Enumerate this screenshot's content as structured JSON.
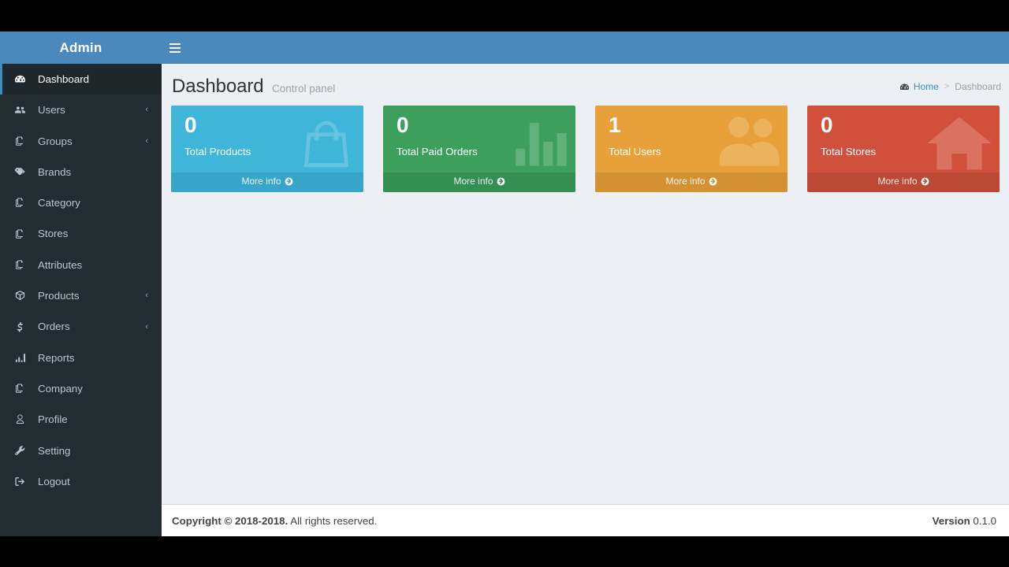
{
  "app": {
    "brand": "Admin",
    "navbar": {
      "toggle_icon": "hamburger-icon"
    },
    "colors": {
      "navbar_blue": "#4b89bc",
      "sidebar_dark": "#222d32",
      "sidebar_active": "#1e282c",
      "accent": "#3c8dbc",
      "content_bg": "#ecf0f5",
      "box_aqua": "#3fb5da",
      "box_green": "#3c9f5c",
      "box_yellow": "#e8a13a",
      "box_red": "#d1503c"
    }
  },
  "sidebar": {
    "items": [
      {
        "label": "Dashboard",
        "icon": "dashboard-icon",
        "active": true,
        "caret": false
      },
      {
        "label": "Users",
        "icon": "users-icon",
        "active": false,
        "caret": true
      },
      {
        "label": "Groups",
        "icon": "copy-icon",
        "active": false,
        "caret": true
      },
      {
        "label": "Brands",
        "icon": "tags-icon",
        "active": false,
        "caret": false
      },
      {
        "label": "Category",
        "icon": "copy-icon",
        "active": false,
        "caret": false
      },
      {
        "label": "Stores",
        "icon": "copy-icon",
        "active": false,
        "caret": false
      },
      {
        "label": "Attributes",
        "icon": "copy-icon",
        "active": false,
        "caret": false
      },
      {
        "label": "Products",
        "icon": "cube-icon",
        "active": false,
        "caret": true
      },
      {
        "label": "Orders",
        "icon": "dollar-icon",
        "active": false,
        "caret": true
      },
      {
        "label": "Reports",
        "icon": "bar-chart-icon",
        "active": false,
        "caret": false
      },
      {
        "label": "Company",
        "icon": "copy-icon",
        "active": false,
        "caret": false
      },
      {
        "label": "Profile",
        "icon": "user-icon",
        "active": false,
        "caret": false
      },
      {
        "label": "Setting",
        "icon": "wrench-icon",
        "active": false,
        "caret": false
      },
      {
        "label": "Logout",
        "icon": "sign-out-icon",
        "active": false,
        "caret": false
      }
    ],
    "caret_glyph": "‹"
  },
  "content": {
    "title": "Dashboard",
    "subtitle": "Control panel",
    "breadcrumb": {
      "icon": "dashboard-icon",
      "home": "Home",
      "separator": ">",
      "current": "Dashboard"
    },
    "boxes": [
      {
        "number": "0",
        "label": "Total Products",
        "more_info": "More info",
        "icon": "shopping-bag-icon",
        "color": "#3fb5da",
        "footer_color": "#36a5c9"
      },
      {
        "number": "0",
        "label": "Total Paid Orders",
        "more_info": "More info",
        "icon": "bar-chart-icon",
        "color": "#3c9f5c",
        "footer_color": "#358f52"
      },
      {
        "number": "1",
        "label": "Total Users",
        "more_info": "More info",
        "icon": "users-icon",
        "color": "#e8a13a",
        "footer_color": "#d29233"
      },
      {
        "number": "0",
        "label": "Total Stores",
        "more_info": "More info",
        "icon": "home-icon",
        "color": "#d1503c",
        "footer_color": "#bc4836"
      }
    ]
  },
  "footer": {
    "copyright_bold": "Copyright © 2018-2018.",
    "copyright_rest": " All rights reserved.",
    "version_label": "Version",
    "version_value": " 0.1.0"
  }
}
